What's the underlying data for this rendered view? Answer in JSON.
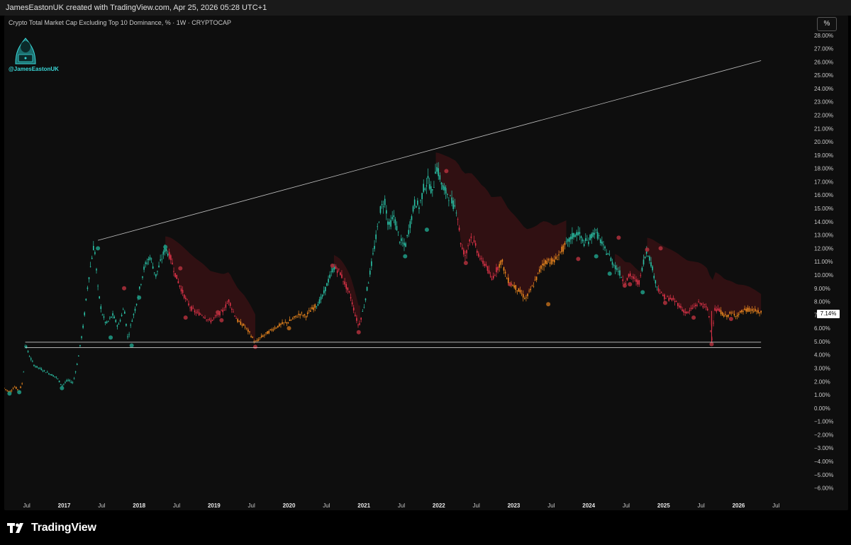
{
  "header": {
    "credit": "JamesEastonUK created with TradingView.com, Apr 25, 2026 05:28 UTC+1"
  },
  "symbol_line": "Crypto Total Market Cap Excluding Top 10 Dominance, % · 1W · CRYPTOCAP",
  "watermark": {
    "handle": "@JamesEastonUK",
    "logo_icon": "hooded-hacker-icon"
  },
  "toolbar": {
    "scale_button": "%"
  },
  "price_label": "7.14%",
  "footer": {
    "brand": "TradingView",
    "logo_icon": "tradingview-logo-icon"
  },
  "colors": {
    "bull": "#2bc4a8",
    "bear": "#e2344a",
    "neutral": "#f28a1e",
    "background": "#0e0e0e",
    "line": "#c0c0c0"
  },
  "chart_data": {
    "type": "candlestick",
    "title": "Crypto Total Market Cap Excluding Top 10 Dominance, % · 1W · CRYPTOCAP",
    "y_unit": "%",
    "ylim": [
      -6.5,
      28.2
    ],
    "y_ticks": [
      "28.00%",
      "27.00%",
      "26.00%",
      "25.00%",
      "24.00%",
      "23.00%",
      "22.00%",
      "21.00%",
      "20.00%",
      "19.00%",
      "18.00%",
      "17.00%",
      "16.00%",
      "15.00%",
      "14.00%",
      "13.00%",
      "12.00%",
      "11.00%",
      "10.00%",
      "9.00%",
      "8.00%",
      "7.00%",
      "6.00%",
      "5.00%",
      "4.00%",
      "3.00%",
      "2.00%",
      "1.00%",
      "0.00%",
      "−1.00%",
      "−2.00%",
      "−3.00%",
      "−4.00%",
      "−5.00%",
      "−6.00%"
    ],
    "x_ticks": [
      {
        "label": "Jul",
        "t": 2016.5,
        "year": false
      },
      {
        "label": "2017",
        "t": 2017.0,
        "year": true
      },
      {
        "label": "Jul",
        "t": 2017.5,
        "year": false
      },
      {
        "label": "2018",
        "t": 2018.0,
        "year": true
      },
      {
        "label": "Jul",
        "t": 2018.5,
        "year": false
      },
      {
        "label": "2019",
        "t": 2019.0,
        "year": true
      },
      {
        "label": "Jul",
        "t": 2019.5,
        "year": false
      },
      {
        "label": "2020",
        "t": 2020.0,
        "year": true
      },
      {
        "label": "Jul",
        "t": 2020.5,
        "year": false
      },
      {
        "label": "2021",
        "t": 2021.0,
        "year": true
      },
      {
        "label": "Jul",
        "t": 2021.5,
        "year": false
      },
      {
        "label": "2022",
        "t": 2022.0,
        "year": true
      },
      {
        "label": "Jul",
        "t": 2022.5,
        "year": false
      },
      {
        "label": "2023",
        "t": 2023.0,
        "year": true
      },
      {
        "label": "Jul",
        "t": 2023.5,
        "year": false
      },
      {
        "label": "2024",
        "t": 2024.0,
        "year": true
      },
      {
        "label": "Jul",
        "t": 2024.5,
        "year": false
      },
      {
        "label": "2025",
        "t": 2025.0,
        "year": true
      },
      {
        "label": "Jul",
        "t": 2025.5,
        "year": false
      },
      {
        "label": "2026",
        "t": 2026.0,
        "year": true
      },
      {
        "label": "Jul",
        "t": 2026.5,
        "year": false
      }
    ],
    "xlim": [
      2016.2,
      2026.8
    ],
    "series_path": [
      [
        2016.2,
        1.5
      ],
      [
        2016.27,
        1.2
      ],
      [
        2016.34,
        1.6
      ],
      [
        2016.4,
        1.3
      ],
      [
        2016.45,
        2.0
      ],
      [
        2016.48,
        4.9
      ],
      [
        2016.53,
        4.0
      ],
      [
        2016.6,
        3.2
      ],
      [
        2016.7,
        2.9
      ],
      [
        2016.8,
        2.6
      ],
      [
        2016.9,
        2.3
      ],
      [
        2016.97,
        1.7
      ],
      [
        2017.05,
        2.1
      ],
      [
        2017.12,
        1.9
      ],
      [
        2017.18,
        3.5
      ],
      [
        2017.25,
        6.0
      ],
      [
        2017.32,
        9.5
      ],
      [
        2017.4,
        12.4
      ],
      [
        2017.45,
        9.0
      ],
      [
        2017.5,
        7.2
      ],
      [
        2017.56,
        6.3
      ],
      [
        2017.65,
        7.0
      ],
      [
        2017.72,
        6.1
      ],
      [
        2017.8,
        7.6
      ],
      [
        2017.85,
        5.2
      ],
      [
        2017.9,
        6.5
      ],
      [
        2017.95,
        7.5
      ],
      [
        2018.0,
        8.8
      ],
      [
        2018.07,
        10.6
      ],
      [
        2018.15,
        11.4
      ],
      [
        2018.22,
        9.9
      ],
      [
        2018.3,
        11.2
      ],
      [
        2018.35,
        12.0
      ],
      [
        2018.42,
        11.3
      ],
      [
        2018.48,
        10.1
      ],
      [
        2018.55,
        9.1
      ],
      [
        2018.62,
        8.2
      ],
      [
        2018.68,
        7.6
      ],
      [
        2018.75,
        7.2
      ],
      [
        2018.85,
        7.0
      ],
      [
        2018.95,
        6.5
      ],
      [
        2019.05,
        7.0
      ],
      [
        2019.12,
        7.3
      ],
      [
        2019.2,
        8.1
      ],
      [
        2019.25,
        7.3
      ],
      [
        2019.32,
        6.5
      ],
      [
        2019.4,
        6.2
      ],
      [
        2019.48,
        5.6
      ],
      [
        2019.55,
        4.9
      ],
      [
        2019.62,
        5.3
      ],
      [
        2019.7,
        5.6
      ],
      [
        2019.8,
        6.0
      ],
      [
        2019.9,
        6.3
      ],
      [
        2020.0,
        6.5
      ],
      [
        2020.08,
        6.8
      ],
      [
        2020.15,
        7.1
      ],
      [
        2020.22,
        6.9
      ],
      [
        2020.3,
        7.4
      ],
      [
        2020.38,
        7.8
      ],
      [
        2020.45,
        8.4
      ],
      [
        2020.52,
        9.5
      ],
      [
        2020.6,
        10.6
      ],
      [
        2020.68,
        10.2
      ],
      [
        2020.75,
        9.3
      ],
      [
        2020.82,
        8.4
      ],
      [
        2020.88,
        7.1
      ],
      [
        2020.93,
        6.1
      ],
      [
        2021.0,
        7.6
      ],
      [
        2021.07,
        9.8
      ],
      [
        2021.15,
        12.4
      ],
      [
        2021.22,
        14.9
      ],
      [
        2021.28,
        15.6
      ],
      [
        2021.33,
        13.6
      ],
      [
        2021.4,
        14.4
      ],
      [
        2021.48,
        12.6
      ],
      [
        2021.55,
        12.1
      ],
      [
        2021.62,
        13.9
      ],
      [
        2021.68,
        15.5
      ],
      [
        2021.74,
        15.1
      ],
      [
        2021.8,
        16.6
      ],
      [
        2021.86,
        17.1
      ],
      [
        2021.92,
        16.0
      ],
      [
        2021.96,
        18.3
      ],
      [
        2022.02,
        17.2
      ],
      [
        2022.07,
        16.3
      ],
      [
        2022.12,
        16.1
      ],
      [
        2022.18,
        15.4
      ],
      [
        2022.24,
        14.9
      ],
      [
        2022.3,
        12.1
      ],
      [
        2022.36,
        11.4
      ],
      [
        2022.42,
        13.0
      ],
      [
        2022.5,
        12.0
      ],
      [
        2022.57,
        11.0
      ],
      [
        2022.63,
        10.8
      ],
      [
        2022.7,
        9.6
      ],
      [
        2022.77,
        10.4
      ],
      [
        2022.84,
        11.1
      ],
      [
        2022.9,
        9.8
      ],
      [
        2022.95,
        9.4
      ],
      [
        2023.02,
        9.1
      ],
      [
        2023.1,
        8.6
      ],
      [
        2023.16,
        8.2
      ],
      [
        2023.22,
        8.8
      ],
      [
        2023.3,
        9.7
      ],
      [
        2023.38,
        10.8
      ],
      [
        2023.46,
        11.1
      ],
      [
        2023.54,
        11.0
      ],
      [
        2023.62,
        11.7
      ],
      [
        2023.7,
        12.3
      ],
      [
        2023.78,
        12.9
      ],
      [
        2023.86,
        13.2
      ],
      [
        2023.93,
        12.4
      ],
      [
        2024.0,
        12.6
      ],
      [
        2024.08,
        13.3
      ],
      [
        2024.14,
        12.8
      ],
      [
        2024.2,
        12.0
      ],
      [
        2024.26,
        11.6
      ],
      [
        2024.32,
        10.9
      ],
      [
        2024.4,
        10.3
      ],
      [
        2024.48,
        9.4
      ],
      [
        2024.55,
        10.0
      ],
      [
        2024.62,
        9.6
      ],
      [
        2024.68,
        9.4
      ],
      [
        2024.72,
        10.8
      ],
      [
        2024.78,
        11.9
      ],
      [
        2024.84,
        10.7
      ],
      [
        2024.9,
        9.3
      ],
      [
        2024.96,
        8.6
      ],
      [
        2025.02,
        8.3
      ],
      [
        2025.1,
        8.2
      ],
      [
        2025.18,
        7.9
      ],
      [
        2025.25,
        7.4
      ],
      [
        2025.32,
        7.1
      ],
      [
        2025.4,
        7.6
      ],
      [
        2025.48,
        7.9
      ],
      [
        2025.56,
        7.6
      ],
      [
        2025.6,
        7.2
      ],
      [
        2025.64,
        5.0
      ],
      [
        2025.68,
        7.4
      ],
      [
        2025.75,
        7.3
      ],
      [
        2025.82,
        6.9
      ],
      [
        2025.9,
        7.1
      ],
      [
        2025.98,
        7.0
      ],
      [
        2026.06,
        7.3
      ],
      [
        2026.14,
        7.4
      ],
      [
        2026.22,
        7.3
      ],
      [
        2026.3,
        7.14
      ]
    ],
    "trendline": {
      "from": [
        2017.45,
        12.6
      ],
      "to": [
        2026.3,
        26.1
      ]
    },
    "support_lines": [
      4.95,
      4.55
    ],
    "support_line_span": [
      2016.48,
      2026.3
    ],
    "last_value": 7.14
  }
}
